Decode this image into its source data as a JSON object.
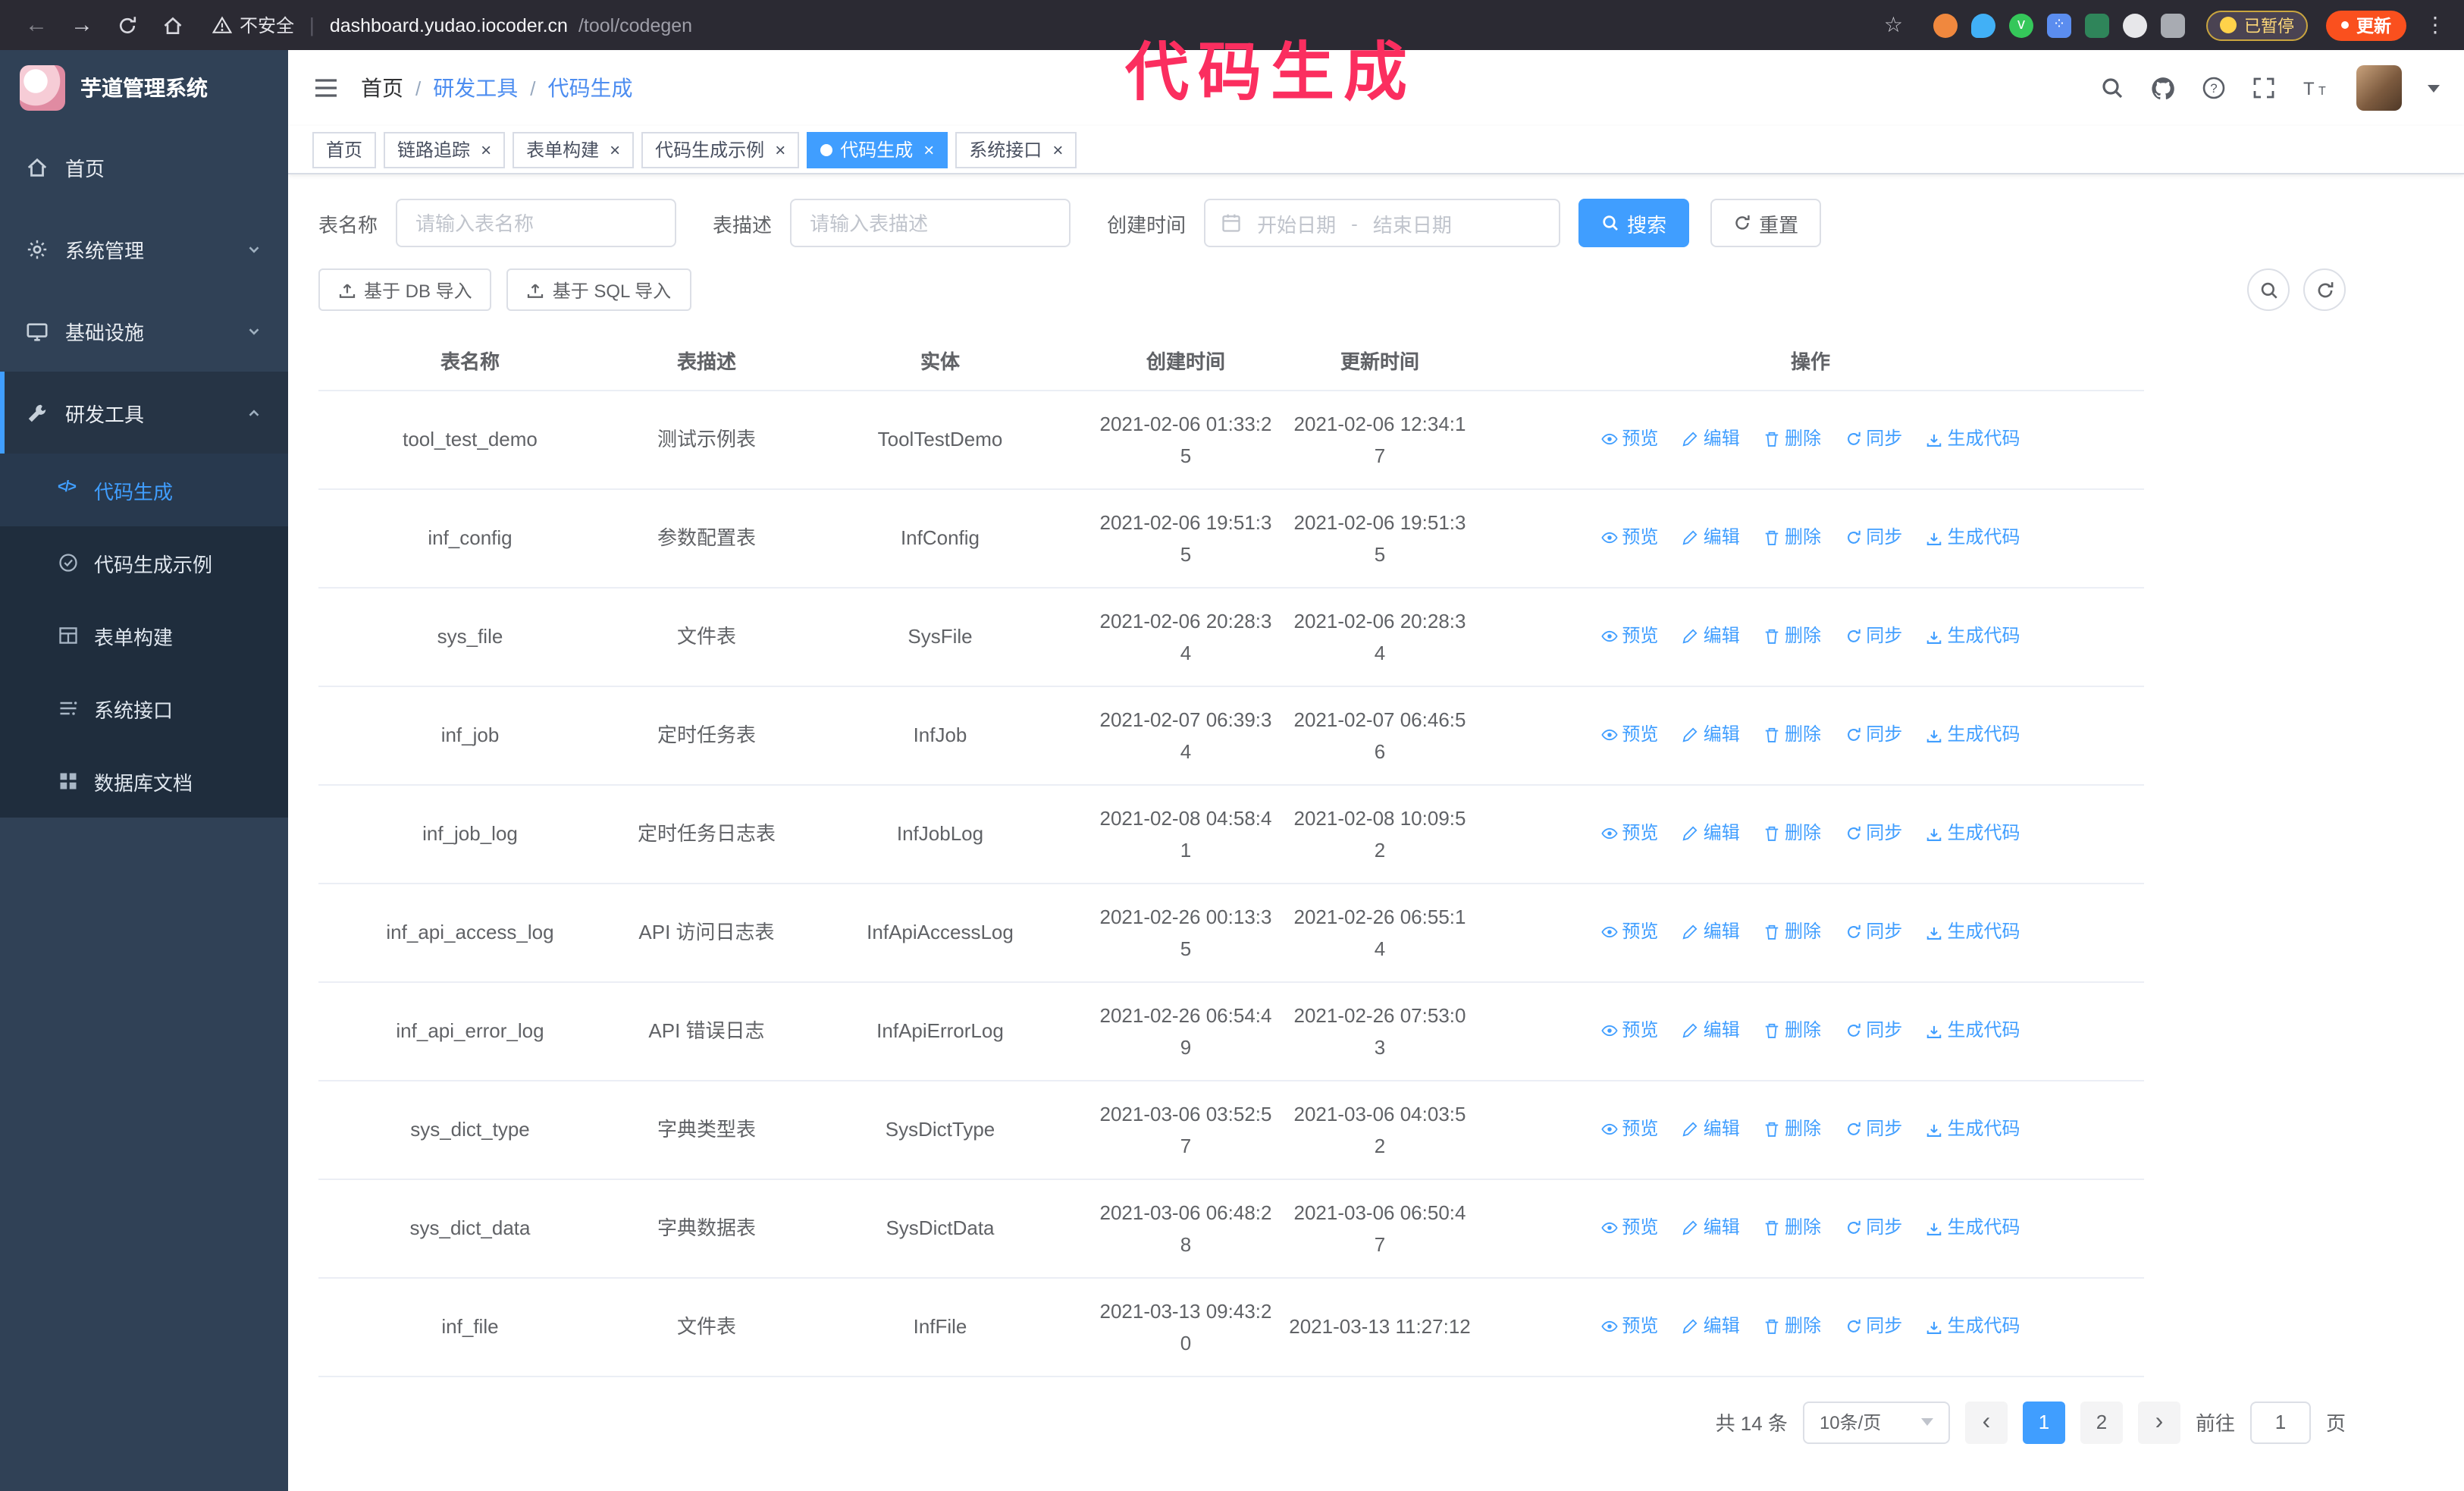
{
  "browser": {
    "security_warning": "不安全",
    "url_domain": "dashboard.yudao.iocoder.cn",
    "url_path": "/tool/codegen",
    "paused_badge": "已暂停",
    "update_button": "更新"
  },
  "annotation": {
    "text": "代码生成",
    "color": "#fb2e5f"
  },
  "colors": {
    "accent": "#409eff",
    "sidebar_bg": "#304156",
    "submenu_bg": "#1f2d3d",
    "update_button_bg": "#fa501e"
  },
  "icons": {
    "search": "magnifier",
    "github": "octocat",
    "help": "question-circle",
    "fullscreen": "corner-brackets",
    "font_size": "TT",
    "refresh": "circular-arrows",
    "upload": "arrow-up-tray",
    "calendar": "calendar",
    "preview": "eye",
    "edit": "pencil",
    "delete": "trash",
    "sync": "circular-arrows",
    "generate": "arrow-down-tray"
  },
  "sidebar": {
    "logo_title": "芋道管理系统",
    "items": [
      {
        "label": "首页",
        "icon": "home-icon",
        "expandable": false,
        "expanded": false
      },
      {
        "label": "系统管理",
        "icon": "gear-icon",
        "expandable": true,
        "expanded": false
      },
      {
        "label": "基础设施",
        "icon": "monitor-icon",
        "expandable": true,
        "expanded": false
      },
      {
        "label": "研发工具",
        "icon": "tools-icon",
        "expandable": true,
        "expanded": true
      }
    ],
    "submenu": [
      {
        "label": "代码生成",
        "icon": "code-icon",
        "active": true
      },
      {
        "label": "代码生成示例",
        "icon": "example-icon",
        "active": false
      },
      {
        "label": "表单构建",
        "icon": "form-icon",
        "active": false
      },
      {
        "label": "系统接口",
        "icon": "api-icon",
        "active": false
      },
      {
        "label": "数据库文档",
        "icon": "database-icon",
        "active": false
      }
    ]
  },
  "header": {
    "breadcrumb": [
      "首页",
      "研发工具",
      "代码生成"
    ],
    "separator": "/"
  },
  "tabs": [
    {
      "label": "首页",
      "closable": false,
      "active": false
    },
    {
      "label": "链路追踪",
      "closable": true,
      "active": false
    },
    {
      "label": "表单构建",
      "closable": true,
      "active": false
    },
    {
      "label": "代码生成示例",
      "closable": true,
      "active": false
    },
    {
      "label": "代码生成",
      "closable": true,
      "active": true
    },
    {
      "label": "系统接口",
      "closable": true,
      "active": false
    }
  ],
  "search_form": {
    "table_name_label": "表名称",
    "table_name_placeholder": "请输入表名称",
    "table_desc_label": "表描述",
    "table_desc_placeholder": "请输入表描述",
    "create_time_label": "创建时间",
    "start_date_placeholder": "开始日期",
    "range_separator": "-",
    "end_date_placeholder": "结束日期",
    "search_button": "搜索",
    "reset_button": "重置"
  },
  "toolbar": {
    "import_db": "基于 DB 导入",
    "import_sql": "基于 SQL 导入"
  },
  "table": {
    "columns": [
      "表名称",
      "表描述",
      "实体",
      "创建时间",
      "更新时间",
      "操作"
    ],
    "actions": [
      "预览",
      "编辑",
      "删除",
      "同步",
      "生成代码"
    ],
    "rows": [
      {
        "name": "tool_test_demo",
        "desc": "测试示例表",
        "entity": "ToolTestDemo",
        "created": "2021-02-06 01:33:25",
        "updated": "2021-02-06 12:34:17"
      },
      {
        "name": "inf_config",
        "desc": "参数配置表",
        "entity": "InfConfig",
        "created": "2021-02-06 19:51:35",
        "updated": "2021-02-06 19:51:35"
      },
      {
        "name": "sys_file",
        "desc": "文件表",
        "entity": "SysFile",
        "created": "2021-02-06 20:28:34",
        "updated": "2021-02-06 20:28:34"
      },
      {
        "name": "inf_job",
        "desc": "定时任务表",
        "entity": "InfJob",
        "created": "2021-02-07 06:39:34",
        "updated": "2021-02-07 06:46:56"
      },
      {
        "name": "inf_job_log",
        "desc": "定时任务日志表",
        "entity": "InfJobLog",
        "created": "2021-02-08 04:58:41",
        "updated": "2021-02-08 10:09:52"
      },
      {
        "name": "inf_api_access_log",
        "desc": "API 访问日志表",
        "entity": "InfApiAccessLog",
        "created": "2021-02-26 00:13:35",
        "updated": "2021-02-26 06:55:14"
      },
      {
        "name": "inf_api_error_log",
        "desc": "API 错误日志",
        "entity": "InfApiErrorLog",
        "created": "2021-02-26 06:54:49",
        "updated": "2021-02-26 07:53:03"
      },
      {
        "name": "sys_dict_type",
        "desc": "字典类型表",
        "entity": "SysDictType",
        "created": "2021-03-06 03:52:57",
        "updated": "2021-03-06 04:03:52"
      },
      {
        "name": "sys_dict_data",
        "desc": "字典数据表",
        "entity": "SysDictData",
        "created": "2021-03-06 06:48:28",
        "updated": "2021-03-06 06:50:47"
      },
      {
        "name": "inf_file",
        "desc": "文件表",
        "entity": "InfFile",
        "created": "2021-03-13 09:43:20",
        "updated": "2021-03-13 11:27:12"
      }
    ]
  },
  "pagination": {
    "total": "共 14 条",
    "page_size": "10条/页",
    "pages": [
      {
        "label": "1",
        "active": true
      },
      {
        "label": "2",
        "active": false
      }
    ],
    "goto_label": "前往",
    "goto_value": "1",
    "page_label": "页"
  }
}
